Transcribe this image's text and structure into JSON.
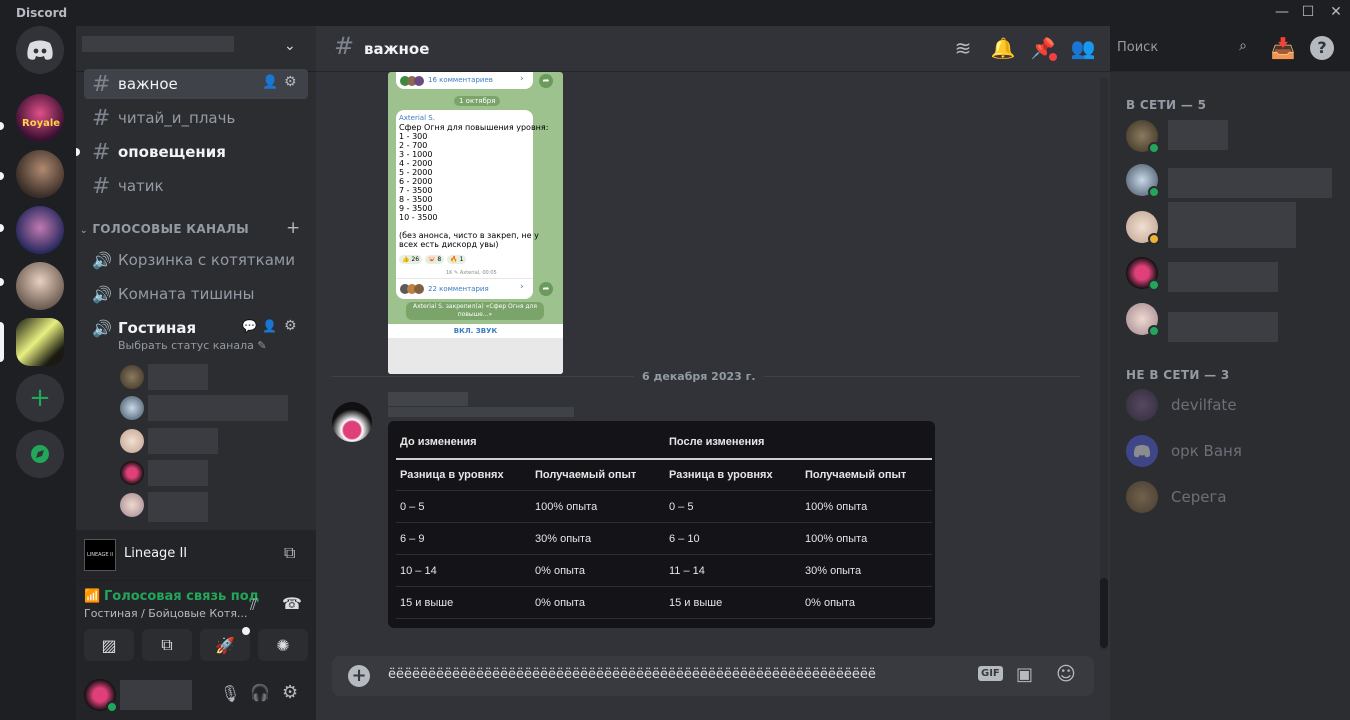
{
  "window": {
    "title": "Discord",
    "controls": [
      "—",
      "☐",
      "✕"
    ]
  },
  "guilds": {
    "items": [
      {
        "name": "discord-home",
        "icon": "discord-logo-icon"
      },
      {
        "name": "server-royale",
        "label": "Royale"
      },
      {
        "name": "server-2"
      },
      {
        "name": "server-3"
      },
      {
        "name": "server-4"
      },
      {
        "name": "server-5-active"
      }
    ],
    "add_icon": "+",
    "explore_icon": "compass-icon"
  },
  "sidebar": {
    "channels": [
      {
        "label": "важное",
        "state": "active"
      },
      {
        "label": "читай_и_плачь",
        "state": "normal"
      },
      {
        "label": "оповещения",
        "state": "unread"
      },
      {
        "label": "чатик",
        "state": "normal"
      }
    ],
    "voice_category": "ГОЛОСОВЫЕ КАНАЛЫ",
    "voice_channels": [
      {
        "label": "Корзинка с котятками"
      },
      {
        "label": "Комната тишины"
      },
      {
        "label": "Гостиная"
      }
    ],
    "voice_status_placeholder": "Выбрать статус канала",
    "activity": {
      "game": "Lineage II",
      "logo_text": "LINEAGE II"
    },
    "voice_connection": {
      "status": "Голосовая связь под",
      "location": "Гостиная / Бойцовые Котя..."
    }
  },
  "header": {
    "channel": "важное",
    "search_placeholder": "Поиск"
  },
  "messages": {
    "telegram_screenshot": {
      "comments_top": "16 комментариев",
      "date_pill": "1 октября",
      "author": "Axterial S.",
      "text": "Сфер Огня для повышения уровня:\n1 - 300\n2 - 700\n3 - 1000\n4 - 2000\n5 - 2000\n6 - 2000\n7 - 3500\n8 - 3500\n9 - 3500\n10 - 3500\n\n(без анонса, чисто в закреп, не у\nвсех есть дискорд увы)",
      "reactions": [
        "👍 26",
        "🐷 8",
        "🔥 1"
      ],
      "meta": "1K ✎ Axterial, 00:05",
      "comments_bottom": "22 комментария",
      "pinned_notice": "Axterial S. закрепил(а) «Сфер Огня для повыше...»",
      "bottom_button": "ВКЛ. ЗВУК"
    },
    "date_divider": "6 декабря 2023 г.",
    "table": {
      "group_headers": [
        "До изменения",
        "После изменения"
      ],
      "columns": [
        "Разница в уровнях",
        "Получаемый опыт",
        "Разница в уровнях",
        "Получаемый опыт"
      ],
      "rows": [
        [
          "0 – 5",
          "100% опыта",
          "0 – 5",
          "100% опыта"
        ],
        [
          "6 – 9",
          "30% опыта",
          "6 – 10",
          "100% опыта"
        ],
        [
          "10 – 14",
          "0% опыта",
          "11 – 14",
          "30% опыта"
        ],
        [
          "15 и выше",
          "0% опыта",
          "15 и выше",
          "0% опыта"
        ]
      ]
    }
  },
  "composer": {
    "value": "ёёёёёёёёёёёёёёёёёёёёёёёёёёёёёёёёёёёёёёёёёёёёёёёёёёёёёёёёёёёёё",
    "gif_label": "GIF"
  },
  "members": {
    "online_header": "В СЕТИ — 5",
    "offline_header": "НЕ В СЕТИ — 3",
    "offline": [
      "devilfate",
      "орк Ваня",
      "Серега"
    ]
  },
  "colors": {
    "accent_green": "#23a55a",
    "voice_green": "#23a55a",
    "danger_red": "#f23f43",
    "idle_yellow": "#f0b232"
  }
}
